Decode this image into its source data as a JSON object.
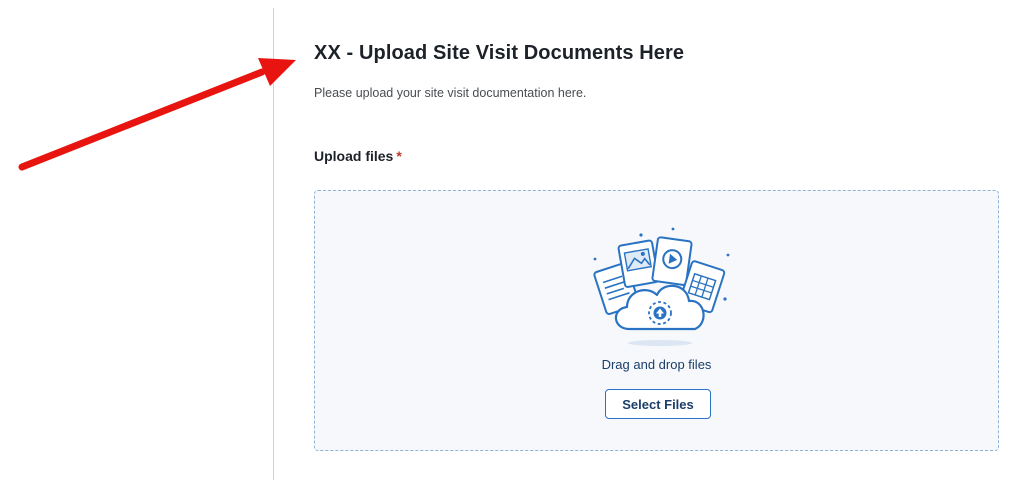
{
  "page": {
    "title": "XX - Upload Site Visit Documents Here",
    "description": "Please upload your site visit documentation here."
  },
  "upload": {
    "label": "Upload files",
    "required_marker": "*",
    "drag_drop_text": "Drag and drop files",
    "select_button_label": "Select Files",
    "illustration_icon": "cloud-upload-documents-icon"
  },
  "annotation": {
    "arrow_color": "#e8140f",
    "arrow_icon": "red-arrow-pointer"
  },
  "colors": {
    "accent": "#2a73c2",
    "dropzone_border": "#8fb3d6",
    "dropzone_background": "#f6f8fb",
    "required": "#c0392b"
  }
}
